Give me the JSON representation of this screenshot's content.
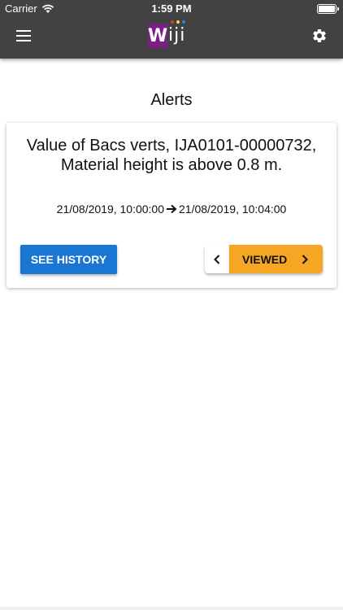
{
  "status_bar": {
    "carrier": "Carrier",
    "time": "1:59 PM",
    "wifi_icon": "wifi-icon",
    "battery_icon": "battery-icon"
  },
  "header": {
    "menu_icon": "hamburger-menu-icon",
    "logo_text": "Wiji",
    "settings_icon": "gear-icon",
    "background_color": "#424242",
    "logo_color": "#7b1f87"
  },
  "page": {
    "title": "Alerts"
  },
  "alert": {
    "title": "Value of Bacs verts, IJA0101-00000732, Material height is above 0.8 m.",
    "start": "21/08/2019, 10:00:00",
    "end": "21/08/2019, 10:04:00",
    "history_label": "SEE HISTORY",
    "state_label": "VIEWED",
    "history_color": "#1976d2",
    "state_color": "#f5a623"
  }
}
